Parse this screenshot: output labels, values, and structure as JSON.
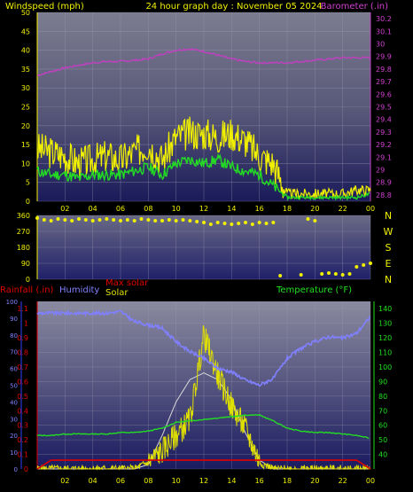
{
  "header": {
    "left": "Windspeed (mph)",
    "center": "24 hour graph day : November 05 2024",
    "right": "Barometer (.in)"
  },
  "colors": {
    "wind_avg": "#22dd22",
    "wind_gust": "#f0f000",
    "barometer": "#c040c0",
    "direction": "#f0f000",
    "rainfall": "#e00000",
    "humidity": "#8080ff",
    "max_solar": "#d8d8d8",
    "solar": "#e0e000",
    "temperature": "#22dd22",
    "axis_left_bottom": "#3040ff",
    "axis_right_bottom": "#20e020"
  },
  "chart_data": [
    {
      "type": "line",
      "title": "24 hour graph day : November 05 2024",
      "ylabel": "Windspeed (mph)",
      "y2label": "Barometer (.in)",
      "x_ticks": [
        "02",
        "04",
        "06",
        "08",
        "10",
        "12",
        "14",
        "16",
        "18",
        "20",
        "22",
        "00"
      ],
      "y_ticks": [
        0,
        5,
        10,
        15,
        20,
        25,
        30,
        35,
        40,
        45,
        50
      ],
      "y2_ticks": [
        "28.8",
        "28.9",
        "29",
        "29.1",
        "29.2",
        "29.3",
        "29.4",
        "29.5",
        "29.6",
        "29.7",
        "29.8",
        "29.9",
        "30",
        "30.1",
        "30.2"
      ],
      "ylim": [
        0,
        50
      ],
      "y2lim": [
        28.75,
        30.25
      ],
      "x_hours": [
        0,
        1,
        2,
        3,
        4,
        5,
        6,
        7,
        8,
        9,
        10,
        11,
        12,
        13,
        14,
        15,
        16,
        17,
        18,
        19,
        20,
        21,
        22,
        23,
        24
      ],
      "series": [
        {
          "key": "gust",
          "values": [
            14,
            13,
            12,
            10,
            11,
            12,
            11,
            13,
            15,
            11,
            17,
            18,
            18,
            17,
            18,
            16,
            12,
            10,
            2,
            2,
            2,
            2,
            2,
            3,
            3
          ]
        },
        {
          "key": "avg",
          "values": [
            8,
            7,
            7,
            6,
            7,
            7,
            7,
            8,
            9,
            7,
            10,
            11,
            10,
            11,
            9,
            8,
            7,
            4,
            1,
            1,
            1,
            1,
            1,
            1,
            2
          ]
        },
        {
          "key": "barometer",
          "values": [
            29.75,
            29.78,
            29.81,
            29.83,
            29.85,
            29.86,
            29.86,
            29.87,
            29.88,
            29.92,
            29.95,
            29.96,
            29.94,
            29.91,
            29.88,
            29.86,
            29.85,
            29.85,
            29.85,
            29.86,
            29.87,
            29.88,
            29.89,
            29.89,
            29.89
          ]
        }
      ]
    },
    {
      "type": "scatter",
      "ylabel": "Wind direction",
      "y_ticks": [
        0,
        90,
        180,
        270,
        360
      ],
      "ylim": [
        0,
        360
      ],
      "compass_labels": [
        "N",
        "W",
        "S",
        "E",
        "N"
      ],
      "x": [
        0,
        0.5,
        1,
        1.5,
        2,
        2.5,
        3,
        3.5,
        4,
        4.5,
        5,
        5.5,
        6,
        6.5,
        7,
        7.5,
        8,
        8.5,
        9,
        9.5,
        10,
        10.5,
        11,
        11.5,
        12,
        12.5,
        13,
        13.5,
        14,
        14.5,
        15,
        15.5,
        16,
        16.5,
        17,
        17.5,
        19,
        19.5,
        20,
        20.5,
        21,
        21.5,
        22,
        22.5,
        23,
        23.5,
        24
      ],
      "values": [
        345,
        335,
        330,
        340,
        335,
        330,
        340,
        335,
        330,
        335,
        340,
        335,
        330,
        335,
        330,
        340,
        335,
        330,
        330,
        335,
        330,
        335,
        330,
        325,
        320,
        310,
        320,
        315,
        310,
        315,
        320,
        310,
        320,
        315,
        320,
        20,
        25,
        340,
        330,
        30,
        35,
        30,
        25,
        30,
        70,
        80,
        90
      ]
    },
    {
      "type": "line",
      "labels": {
        "rainfall": "Rainfall (.in)",
        "humidity": "Humidity",
        "max_solar": "Max solar",
        "solar": "Solar",
        "temperature": "Temperature (°F)"
      },
      "y_ticks_left": [
        "0",
        "0.1",
        "0.2",
        "0.3",
        "0.4",
        "0.5",
        "0.6",
        "0.7",
        "0.8",
        "0.9",
        "1",
        "1.1"
      ],
      "ylim_left": [
        0,
        1.15
      ],
      "y_ticks_humidity": [
        0,
        10,
        20,
        30,
        40,
        50,
        60,
        70,
        80,
        90,
        100
      ],
      "ylim_humidity": [
        0,
        100
      ],
      "y_ticks_right": [
        40,
        50,
        60,
        70,
        80,
        90,
        100,
        110,
        120,
        130,
        140
      ],
      "ylim_right": [
        30,
        145
      ],
      "x_ticks": [
        "02",
        "04",
        "06",
        "08",
        "10",
        "12",
        "14",
        "16",
        "18",
        "20",
        "22",
        "00"
      ],
      "x_hours": [
        0,
        1,
        2,
        3,
        4,
        5,
        6,
        7,
        8,
        9,
        10,
        11,
        12,
        13,
        14,
        15,
        16,
        17,
        18,
        19,
        20,
        21,
        22,
        23,
        24
      ],
      "series": [
        {
          "key": "rainfall",
          "values": [
            0.0,
            0.06,
            0.06,
            0.06,
            0.06,
            0.06,
            0.06,
            0.06,
            0.06,
            0.06,
            0.06,
            0.06,
            0.06,
            0.06,
            0.06,
            0.06,
            0.06,
            0.06,
            0.06,
            0.06,
            0.06,
            0.06,
            0.06,
            0.06,
            0.0
          ]
        },
        {
          "key": "humidity",
          "values": [
            93,
            93,
            93,
            93,
            93,
            93,
            94,
            88,
            86,
            84,
            76,
            70,
            66,
            60,
            58,
            53,
            50,
            54,
            66,
            72,
            76,
            79,
            78,
            81,
            91
          ]
        },
        {
          "key": "temperature",
          "values": [
            53,
            53,
            54,
            54,
            54,
            54,
            55,
            55,
            56,
            58,
            62,
            63,
            64,
            65,
            66,
            67,
            67,
            63,
            58,
            56,
            55,
            55,
            54,
            53,
            51
          ]
        },
        {
          "key": "max_solar",
          "values": [
            0,
            0,
            0,
            0,
            0,
            0,
            0,
            0,
            2,
            15,
            30,
            40,
            43,
            40,
            31,
            16,
            4,
            0,
            0,
            0,
            0,
            0,
            0,
            0,
            0
          ]
        },
        {
          "key": "solar",
          "values": [
            0,
            0,
            0,
            0,
            0,
            0,
            0,
            0,
            3,
            8,
            15,
            22,
            60,
            42,
            28,
            18,
            3,
            0,
            0,
            0,
            0,
            0,
            0,
            0,
            0
          ]
        }
      ]
    }
  ]
}
